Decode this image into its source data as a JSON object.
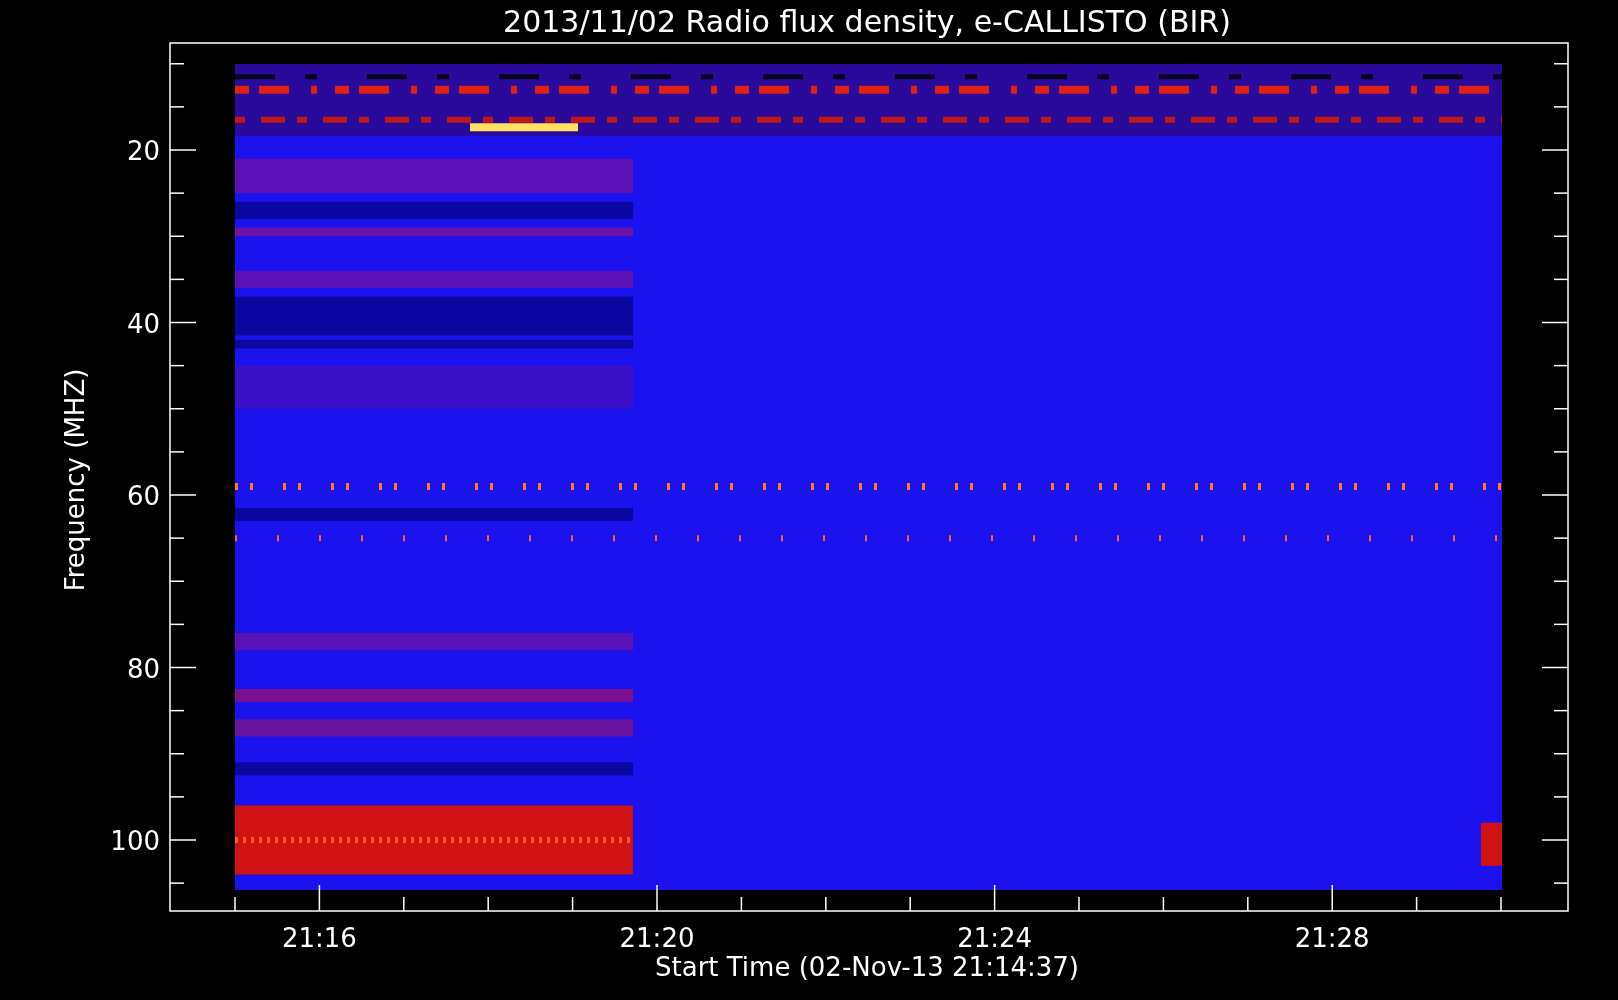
{
  "title": "2013/11/02  Radio flux density, e-CALLISTO (BIR)",
  "y_axis": {
    "label": "Frequency (MHZ)",
    "ticks": [
      "20",
      "40",
      "60",
      "80",
      "100"
    ]
  },
  "x_axis": {
    "label": "Start Time (02-Nov-13 21:14:37)",
    "ticks": [
      "21:16",
      "21:20",
      "21:24",
      "21:28"
    ]
  }
}
